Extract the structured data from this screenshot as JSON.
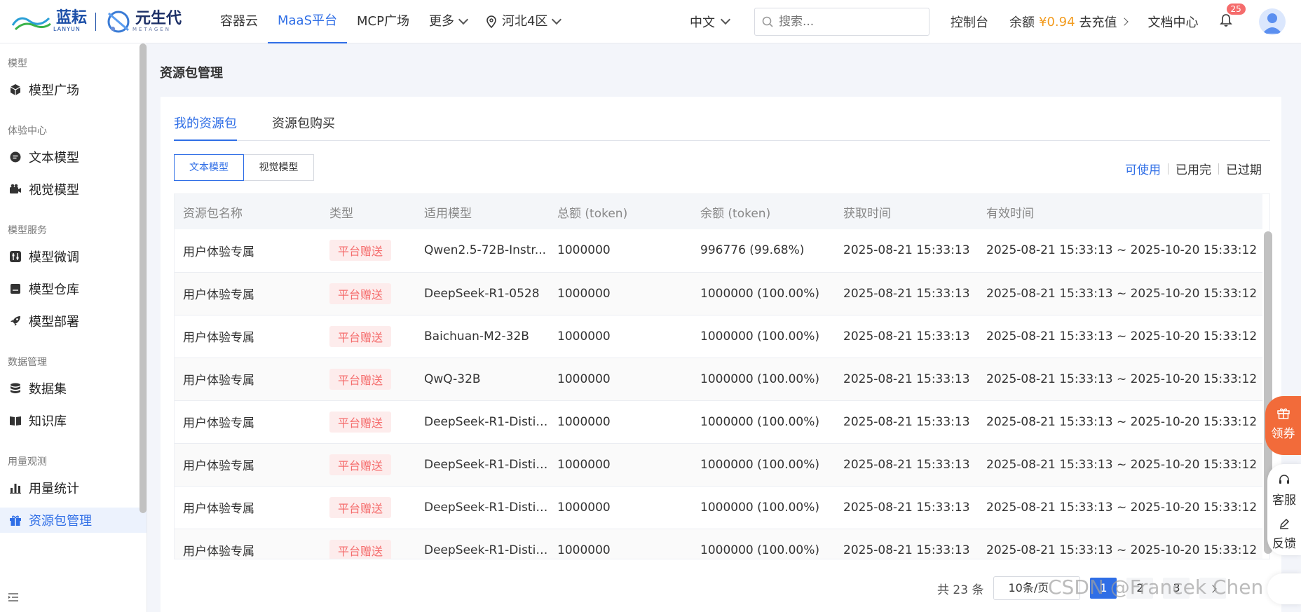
{
  "brand": {
    "name1": "蓝耘",
    "sub1": "LANYUN",
    "name2": "元生代",
    "sub2": "METAGEN"
  },
  "nav": {
    "items": [
      {
        "label": "容器云"
      },
      {
        "label": "MaaS平台"
      },
      {
        "label": "MCP广场"
      },
      {
        "label": "更多"
      },
      {
        "label": "河北4区"
      }
    ],
    "active": "MaaS平台"
  },
  "header": {
    "language": "中文",
    "search_placeholder": "搜索...",
    "console": "控制台",
    "balance_label": "余额",
    "balance_amount": "¥0.94",
    "recharge": "去充值",
    "docs": "文档中心",
    "notification_count": "25"
  },
  "sidebar": {
    "groups": [
      {
        "title": "模型",
        "items": [
          {
            "label": "模型广场",
            "icon": "cube-icon"
          }
        ]
      },
      {
        "title": "体验中心",
        "items": [
          {
            "label": "文本模型",
            "icon": "chat-icon"
          },
          {
            "label": "视觉模型",
            "icon": "camera-icon"
          }
        ]
      },
      {
        "title": "模型服务",
        "items": [
          {
            "label": "模型微调",
            "icon": "sliders-icon"
          },
          {
            "label": "模型仓库",
            "icon": "archive-icon"
          },
          {
            "label": "模型部署",
            "icon": "rocket-icon"
          }
        ]
      },
      {
        "title": "数据管理",
        "items": [
          {
            "label": "数据集",
            "icon": "database-icon"
          },
          {
            "label": "知识库",
            "icon": "book-icon"
          }
        ]
      },
      {
        "title": "用量观测",
        "items": [
          {
            "label": "用量统计",
            "icon": "bar-chart-icon"
          },
          {
            "label": "资源包管理",
            "icon": "gift-icon"
          }
        ]
      }
    ],
    "active": "资源包管理"
  },
  "page": {
    "title": "资源包管理",
    "tabs": [
      {
        "label": "我的资源包"
      },
      {
        "label": "资源包购买"
      }
    ],
    "segments": [
      {
        "label": "文本模型"
      },
      {
        "label": "视觉模型"
      }
    ],
    "filters": [
      {
        "label": "可使用"
      },
      {
        "label": "已用完"
      },
      {
        "label": "已过期"
      }
    ]
  },
  "table": {
    "columns": [
      "资源包名称",
      "类型",
      "适用模型",
      "总额 (token)",
      "余额 (token)",
      "获取时间",
      "有效时间"
    ],
    "rows": [
      [
        "用户体验专属",
        "平台赠送",
        "Qwen2.5-72B-Instr...",
        "1000000",
        "996776 (99.68%)",
        "2025-08-21 15:33:13",
        "2025-08-21 15:33:13 ~ 2025-10-20 15:33:12"
      ],
      [
        "用户体验专属",
        "平台赠送",
        "DeepSeek-R1-0528",
        "1000000",
        "1000000 (100.00%)",
        "2025-08-21 15:33:13",
        "2025-08-21 15:33:13 ~ 2025-10-20 15:33:12"
      ],
      [
        "用户体验专属",
        "平台赠送",
        "Baichuan-M2-32B",
        "1000000",
        "1000000 (100.00%)",
        "2025-08-21 15:33:13",
        "2025-08-21 15:33:13 ~ 2025-10-20 15:33:12"
      ],
      [
        "用户体验专属",
        "平台赠送",
        "QwQ-32B",
        "1000000",
        "1000000 (100.00%)",
        "2025-08-21 15:33:13",
        "2025-08-21 15:33:13 ~ 2025-10-20 15:33:12"
      ],
      [
        "用户体验专属",
        "平台赠送",
        "DeepSeek-R1-Distil...",
        "1000000",
        "1000000 (100.00%)",
        "2025-08-21 15:33:13",
        "2025-08-21 15:33:13 ~ 2025-10-20 15:33:12"
      ],
      [
        "用户体验专属",
        "平台赠送",
        "DeepSeek-R1-Distil...",
        "1000000",
        "1000000 (100.00%)",
        "2025-08-21 15:33:13",
        "2025-08-21 15:33:13 ~ 2025-10-20 15:33:12"
      ],
      [
        "用户体验专属",
        "平台赠送",
        "DeepSeek-R1-Distil...",
        "1000000",
        "1000000 (100.00%)",
        "2025-08-21 15:33:13",
        "2025-08-21 15:33:13 ~ 2025-10-20 15:33:12"
      ],
      [
        "用户体验专属",
        "平台赠送",
        "DeepSeek-R1-Distil...",
        "1000000",
        "1000000 (100.00%)",
        "2025-08-21 15:33:13",
        "2025-08-21 15:33:13 ~ 2025-10-20 15:33:12"
      ]
    ]
  },
  "pagination": {
    "total": "共 23 条",
    "page_size": "10条/页",
    "pages": [
      "1",
      "2",
      "3"
    ],
    "current": "1"
  },
  "floating": {
    "coupon": "领券",
    "service": "客服",
    "feedback": "反馈"
  },
  "watermark": "CSDN @Francek Chen",
  "colors": {
    "accent": "#2f6ee6",
    "amount": "#f29b1e",
    "tag_red": "#f56c6c",
    "coupon": "#f26b3a"
  }
}
